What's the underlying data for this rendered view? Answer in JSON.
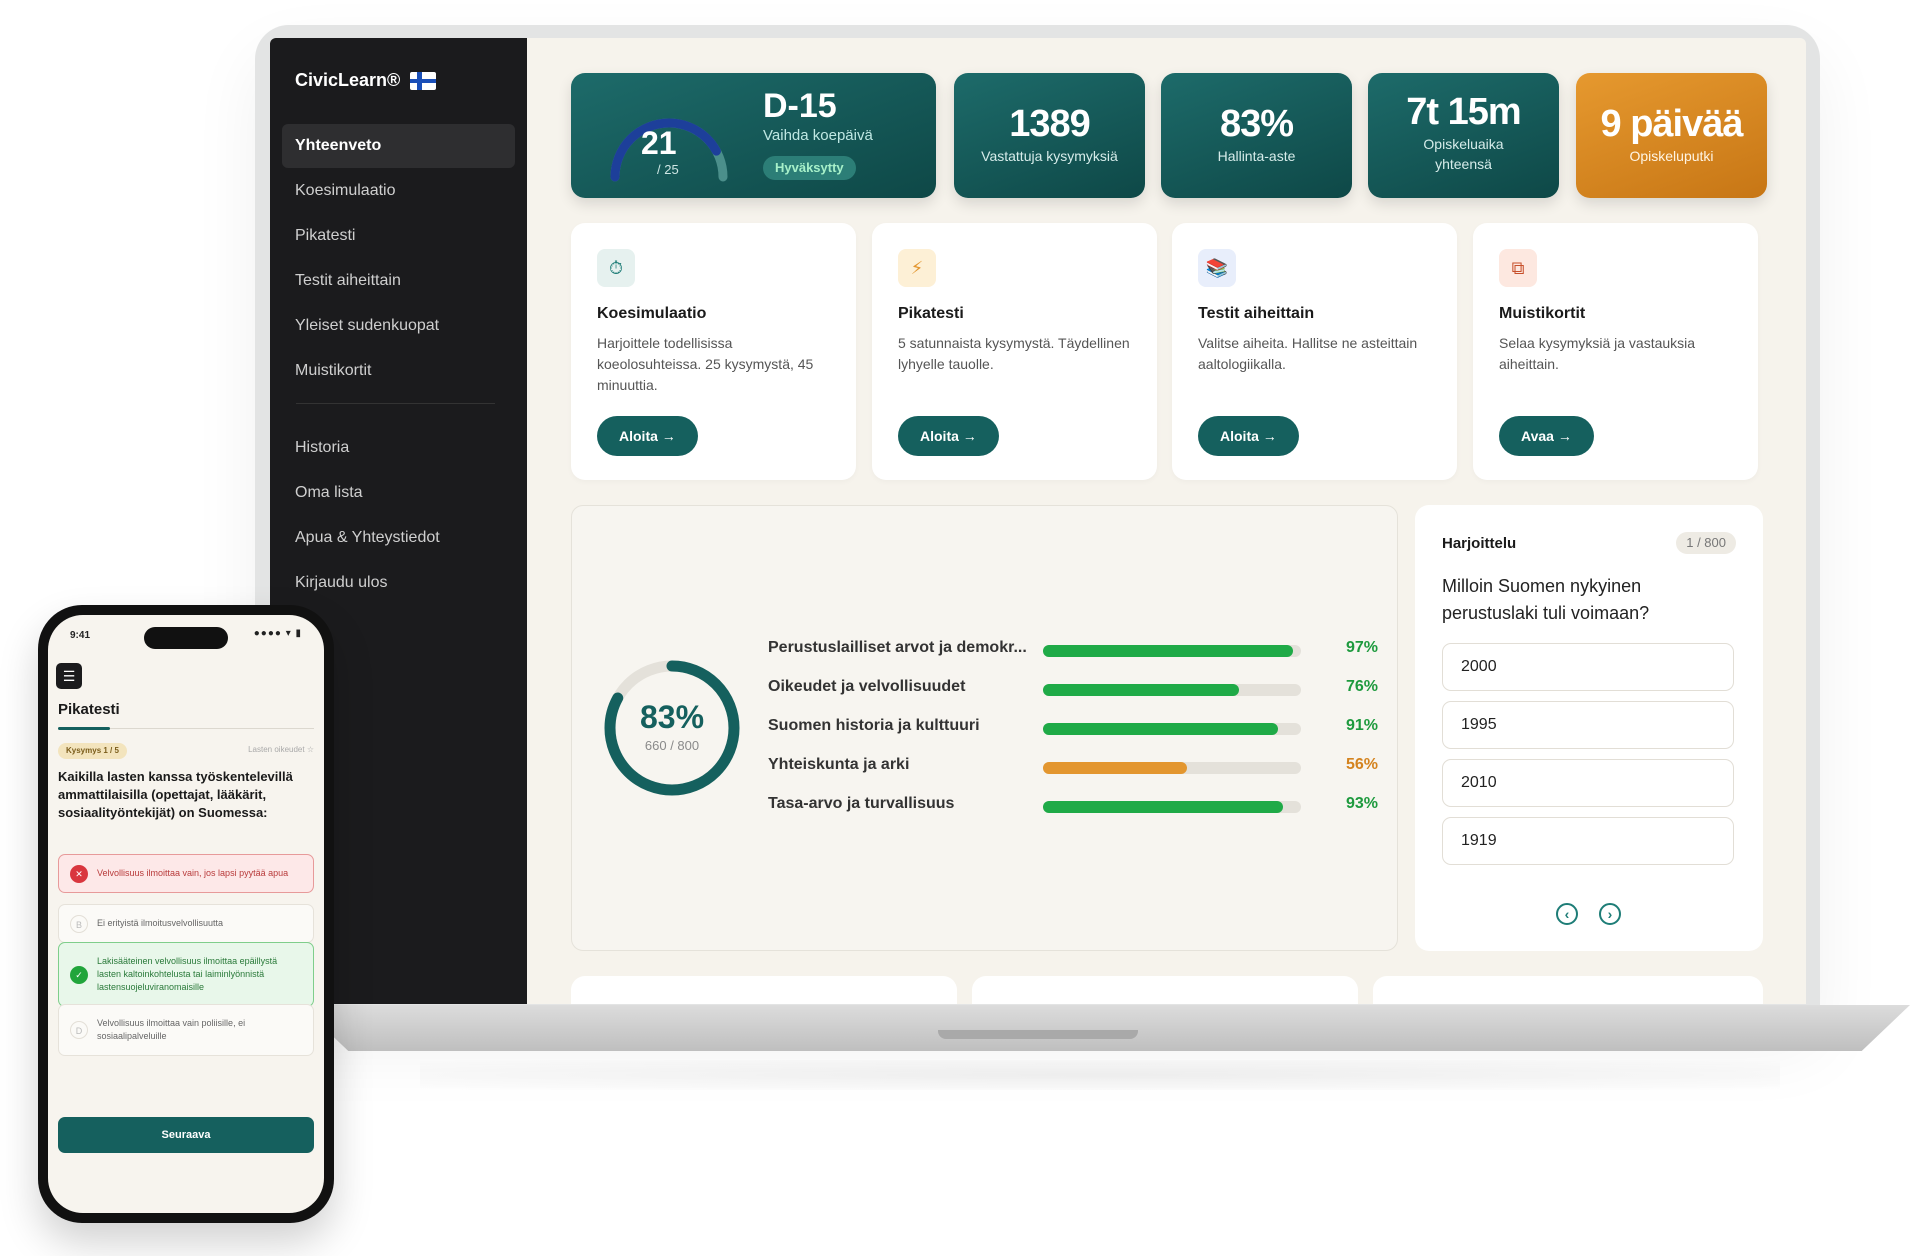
{
  "app": {
    "brand": "CivicLearn®"
  },
  "sidebar": {
    "items": [
      {
        "label": "Yhteenveto",
        "active": true
      },
      {
        "label": "Koesimulaatio"
      },
      {
        "label": "Pikatesti"
      },
      {
        "label": "Testit aiheittain"
      },
      {
        "label": "Yleiset sudenkuopat"
      },
      {
        "label": "Muistikortit"
      }
    ],
    "secondary": [
      {
        "label": "Historia"
      },
      {
        "label": "Oma lista"
      },
      {
        "label": "Apua & Yhteystiedot"
      },
      {
        "label": "Kirjaudu ulos"
      }
    ]
  },
  "stats": {
    "exam": {
      "score": "21",
      "score_total": "/ 25",
      "score_value": 21,
      "score_max": 25,
      "title": "D-15",
      "subtitle": "Vaihda koepäivä",
      "badge": "Hyväksytty"
    },
    "answered": {
      "value": "1389",
      "label": "Vastattuja kysymyksiä"
    },
    "mastery": {
      "value": "83%",
      "label": "Hallinta-aste"
    },
    "time": {
      "value": "7t 15m",
      "label_line1": "Opiskeluaika",
      "label_line2": "yhteensä"
    },
    "streak": {
      "value": "9 päivää",
      "label": "Opiskeluputki"
    }
  },
  "cards": [
    {
      "icon": "timer-icon",
      "glyph": "⏱",
      "title": "Koesimulaatio",
      "desc": "Harjoittele todellisissa koeolosuhteissa. 25 kysymystä, 45 minuuttia.",
      "button": "Aloita →"
    },
    {
      "icon": "lightning-icon",
      "glyph": "⚡",
      "title": "Pikatesti",
      "desc": "5 satunnaista kysymystä. Täydellinen lyhyelle tauolle.",
      "button": "Aloita →"
    },
    {
      "icon": "books-icon",
      "glyph": "📚",
      "title": "Testit aiheittain",
      "desc": "Valitse aiheita. Hallitse ne asteittain aaltologiikalla.",
      "button": "Aloita →"
    },
    {
      "icon": "cards-icon",
      "glyph": "⧉",
      "title": "Muistikortit",
      "desc": "Selaa kysymyksiä ja vastauksia aiheittain.",
      "button": "Avaa →"
    }
  ],
  "progress": {
    "overall_pct": "83%",
    "overall_value": 0.83,
    "overall_sub": "660 / 800",
    "topics": [
      {
        "label": "Perustuslailliset arvot ja demokr...",
        "pct": "97%",
        "value": 0.97,
        "color": "#1faa47"
      },
      {
        "label": "Oikeudet ja velvollisuudet",
        "pct": "76%",
        "value": 0.76,
        "color": "#1faa47"
      },
      {
        "label": "Suomen historia ja kulttuuri",
        "pct": "91%",
        "value": 0.91,
        "color": "#1faa47"
      },
      {
        "label": "Yhteiskunta ja arki",
        "pct": "56%",
        "value": 0.56,
        "color": "#e3962f"
      },
      {
        "label": "Tasa-arvo ja turvallisuus",
        "pct": "93%",
        "value": 0.93,
        "color": "#1faa47"
      }
    ]
  },
  "practice": {
    "title": "Harjoittelu",
    "counter": "1 / 800",
    "question": "Milloin Suomen nykyinen perustuslaki tuli voimaan?",
    "options": [
      "2000",
      "1995",
      "2010",
      "1919"
    ]
  },
  "phone": {
    "time": "9:41",
    "signal": "●●●● ▾ ▮",
    "menu_glyph": "☰",
    "title": "Pikatesti",
    "badge": "Kysymys 1 / 5",
    "report": "Lasten oikeudet ☆",
    "question": "Kaikilla lasten kanssa työskentelevillä ammattilaisilla (opettajat, lääkärit, sosiaalityöntekijät) on Suomessa:",
    "options": [
      {
        "mark": "✕",
        "text": "Velvollisuus ilmoittaa vain, jos lapsi pyytää apua",
        "state": "wrong"
      },
      {
        "mark": "B",
        "text": "Ei erityistä ilmoitusvelvollisuutta",
        "state": "none"
      },
      {
        "mark": "✓",
        "text": "Lakisääteinen velvollisuus ilmoittaa epäillystä lasten kaltoinkohtelusta tai laiminlyönnistä lastensuojeluviranomaisille",
        "state": "right"
      },
      {
        "mark": "D",
        "text": "Velvollisuus ilmoittaa vain poliisille, ei sosiaalipalveluille",
        "state": "none"
      }
    ],
    "next": "Seuraava"
  },
  "colors": {
    "accent": "#15605e",
    "accent_dark": "#0e4847",
    "orange": "#d4831f",
    "success": "#1faa47",
    "warning": "#e3962f",
    "sidebar_bg": "#1b1b1d",
    "page_bg": "#f6f3ec"
  }
}
